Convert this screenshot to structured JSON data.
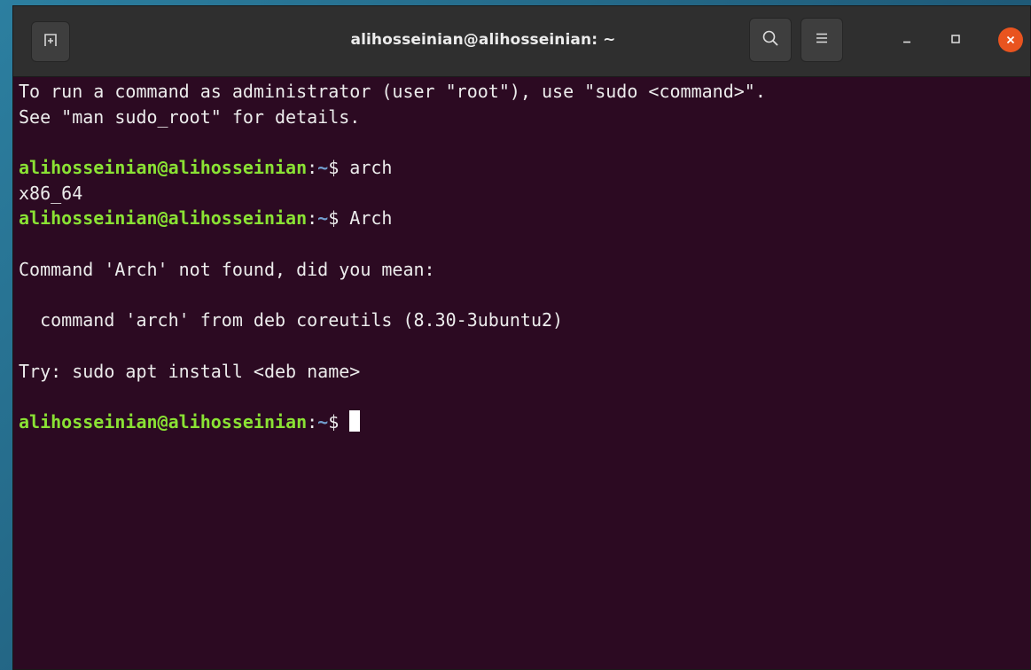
{
  "window": {
    "title": "alihosseinian@alihosseinian: ~"
  },
  "terminal": {
    "lines": [
      "To run a command as administrator (user \"root\"), use \"sudo <command>\".",
      "See \"man sudo_root\" for details."
    ],
    "prompt_user": "alihosseinian@alihosseinian",
    "prompt_colon": ":",
    "prompt_path": "~",
    "prompt_symbol": "$ ",
    "cmd1": "arch",
    "out1": "x86_64",
    "cmd2": "Arch",
    "out2": [
      "Command 'Arch' not found, did you mean:",
      "  command 'arch' from deb coreutils (8.30-3ubuntu2)",
      "Try: sudo apt install <deb name>"
    ]
  },
  "colors": {
    "terminal_bg": "#2c0a22",
    "prompt_user": "#8ae234",
    "prompt_path": "#729fcf",
    "close_button": "#e9541f"
  },
  "icons": {
    "new_tab": "new-tab-icon",
    "search": "search-icon",
    "menu": "hamburger-menu-icon",
    "minimize": "minimize-icon",
    "maximize": "maximize-icon",
    "close": "close-icon"
  }
}
